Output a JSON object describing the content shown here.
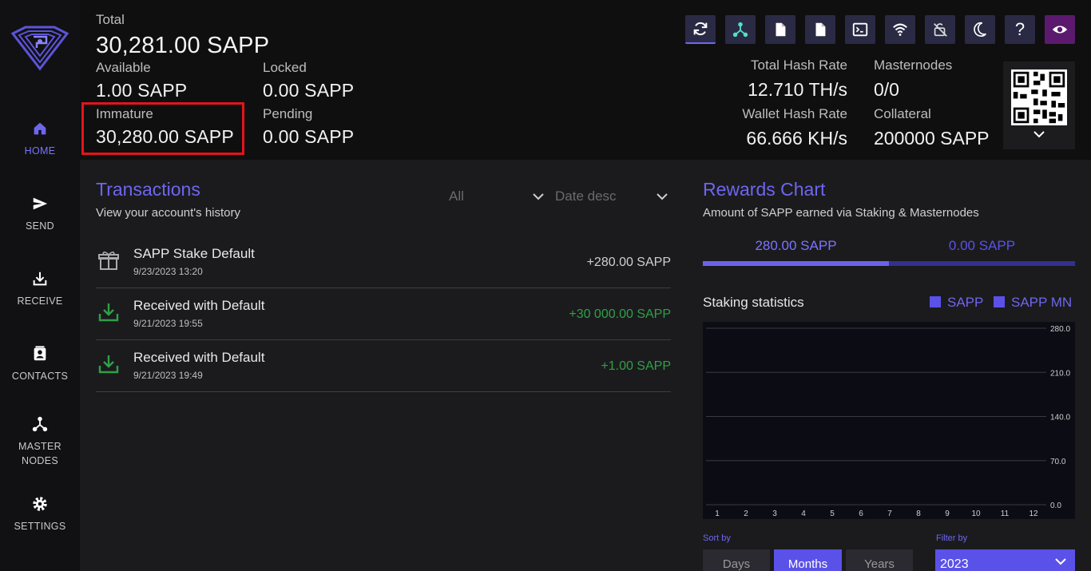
{
  "sidebar": {
    "items": [
      {
        "label": "HOME",
        "icon": "home-icon"
      },
      {
        "label": "SEND",
        "icon": "send-icon"
      },
      {
        "label": "RECEIVE",
        "icon": "receive-icon"
      },
      {
        "label": "CONTACTS",
        "icon": "contacts-icon"
      },
      {
        "label_line1": "MASTER",
        "label_line2": "NODES",
        "icon": "masternodes-icon"
      },
      {
        "label": "SETTINGS",
        "icon": "gear-icon"
      }
    ]
  },
  "balances": {
    "total_label": "Total",
    "total_value": "30,281.00 SAPP",
    "available_label": "Available",
    "available_value": "1.00 SAPP",
    "locked_label": "Locked",
    "locked_value": "0.00 SAPP",
    "immature_label": "Immature",
    "immature_value": "30,280.00 SAPP",
    "pending_label": "Pending",
    "pending_value": "0.00 SAPP"
  },
  "toolbar": {
    "buttons": [
      "refresh-icon",
      "masternode-icon",
      "document-icon",
      "document-icon",
      "terminal-icon",
      "wifi-icon",
      "lock-off-icon",
      "moon-icon",
      "help-icon",
      "eye-icon"
    ],
    "help_label": "?"
  },
  "stats": {
    "total_hash_rate_label": "Total Hash Rate",
    "total_hash_rate_value": "12.710 TH/s",
    "masternodes_label": "Masternodes",
    "masternodes_value": "0/0",
    "wallet_hash_rate_label": "Wallet Hash Rate",
    "wallet_hash_rate_value": "66.666 KH/s",
    "collateral_label": "Collateral",
    "collateral_value": "200000 SAPP"
  },
  "transactions": {
    "title": "Transactions",
    "subtitle": "View your account's history",
    "filter_type": "All",
    "filter_sort": "Date desc",
    "rows": [
      {
        "title": "SAPP Stake Default",
        "date": "9/23/2023 13:20",
        "amount": "+280.00 SAPP",
        "icon": "gift-icon",
        "color": "#cfcfcf"
      },
      {
        "title": "Received with Default",
        "date": "9/21/2023 19:55",
        "amount": "+30 000.00 SAPP",
        "icon": "download-icon",
        "color": "#2fa046"
      },
      {
        "title": "Received with Default",
        "date": "9/21/2023 19:49",
        "amount": "+1.00 SAPP",
        "icon": "download-icon",
        "color": "#2fa046"
      }
    ]
  },
  "rewards": {
    "title": "Rewards Chart",
    "subtitle": "Amount of SAPP earned via Staking & Masternodes",
    "tab_staking": "280.00 SAPP",
    "tab_masternodes": "0.00 SAPP",
    "chart_title": "Staking statistics",
    "legend": [
      "SAPP",
      "SAPP MN"
    ],
    "sort_label": "Sort by",
    "sort_options": [
      "Days",
      "Months",
      "Years"
    ],
    "sort_selected": "Months",
    "filter_label": "Filter by",
    "filter_value": "2023"
  },
  "colors": {
    "accent": "#6e66ee",
    "positive": "#2fa046",
    "highlight": "#e3141b"
  },
  "chart_data": {
    "type": "bar",
    "categories": [
      "1",
      "2",
      "3",
      "4",
      "5",
      "6",
      "7",
      "8",
      "9",
      "10",
      "11",
      "12"
    ],
    "series": [
      {
        "name": "SAPP",
        "values": [
          0,
          0,
          0,
          0,
          0,
          0,
          0,
          0,
          0,
          0,
          0,
          0
        ]
      },
      {
        "name": "SAPP MN",
        "values": [
          0,
          0,
          0,
          0,
          0,
          0,
          0,
          0,
          0,
          0,
          0,
          0
        ]
      }
    ],
    "yticks": [
      "280.0",
      "210.0",
      "140.0",
      "70.0",
      "0.0"
    ],
    "ylim": [
      0,
      280
    ],
    "title": "Staking statistics",
    "grid": true,
    "legend_position": "top-right"
  }
}
